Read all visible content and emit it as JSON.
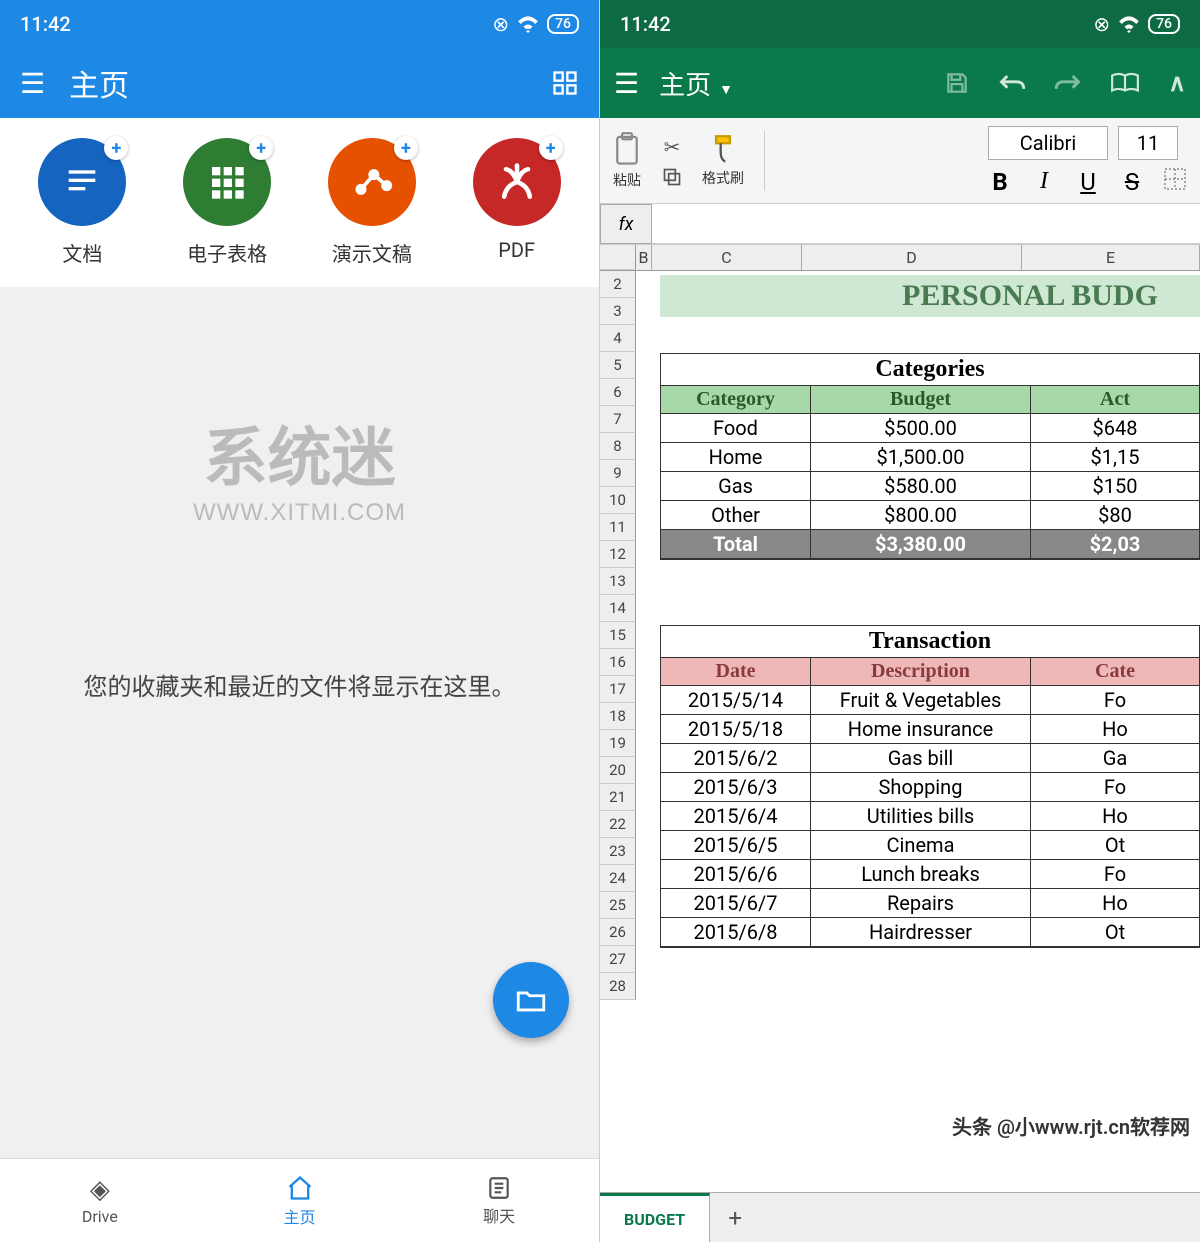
{
  "statusbar": {
    "time": "11:42",
    "battery": "76"
  },
  "left": {
    "header": {
      "title": "主页"
    },
    "quick": [
      {
        "label": "文档",
        "cls": "c-doc"
      },
      {
        "label": "电子表格",
        "cls": "c-sheet"
      },
      {
        "label": "演示文稿",
        "cls": "c-pres"
      },
      {
        "label": "PDF",
        "cls": "c-pdf"
      }
    ],
    "watermark_title": "系统迷",
    "watermark_sub": "WWW.XITMI.COM",
    "empty_message": "您的收藏夹和最近的文件将显示在这里。",
    "bottom": [
      {
        "label": "Drive"
      },
      {
        "label": "主页"
      },
      {
        "label": "聊天"
      }
    ]
  },
  "right": {
    "header": {
      "title": "主页"
    },
    "toolbar": {
      "paste": "粘贴",
      "format": "格式刷",
      "font_name": "Calibri",
      "font_size": "11",
      "bold": "B",
      "italic": "I",
      "underline": "U",
      "strike": "S"
    },
    "fx": "fx",
    "columns": [
      "B",
      "C",
      "D",
      "E"
    ],
    "row_numbers": [
      "2",
      "3",
      "4",
      "5",
      "6",
      "7",
      "8",
      "9",
      "10",
      "11",
      "12",
      "13",
      "14",
      "15",
      "16",
      "17",
      "18",
      "19",
      "20",
      "21",
      "22",
      "23",
      "24",
      "25",
      "26",
      "27",
      "28"
    ],
    "title_banner": "PERSONAL BUDG",
    "categories_title": "Categories",
    "cat_headers": [
      "Category",
      "Budget",
      "Act"
    ],
    "cat_rows": [
      [
        "Food",
        "$500.00",
        "$648"
      ],
      [
        "Home",
        "$1,500.00",
        "$1,15"
      ],
      [
        "Gas",
        "$580.00",
        "$150"
      ],
      [
        "Other",
        "$800.00",
        "$80"
      ]
    ],
    "cat_total": [
      "Total",
      "$3,380.00",
      "$2,03"
    ],
    "trans_title": "Transaction",
    "trans_headers": [
      "Date",
      "Description",
      "Cate"
    ],
    "trans_rows": [
      [
        "2015/5/14",
        "Fruit & Vegetables",
        "Fo"
      ],
      [
        "2015/5/18",
        "Home insurance",
        "Ho"
      ],
      [
        "2015/6/2",
        "Gas bill",
        "Ga"
      ],
      [
        "2015/6/3",
        "Shopping",
        "Fo"
      ],
      [
        "2015/6/4",
        "Utilities bills",
        "Ho"
      ],
      [
        "2015/6/5",
        "Cinema",
        "Ot"
      ],
      [
        "2015/6/6",
        "Lunch breaks",
        "Fo"
      ],
      [
        "2015/6/7",
        "Repairs",
        "Ho"
      ],
      [
        "2015/6/8",
        "Hairdresser",
        "Ot"
      ]
    ],
    "sheet_tab": "BUDGET",
    "attribution": "头条 @小www.rjt.cn软荐网"
  }
}
